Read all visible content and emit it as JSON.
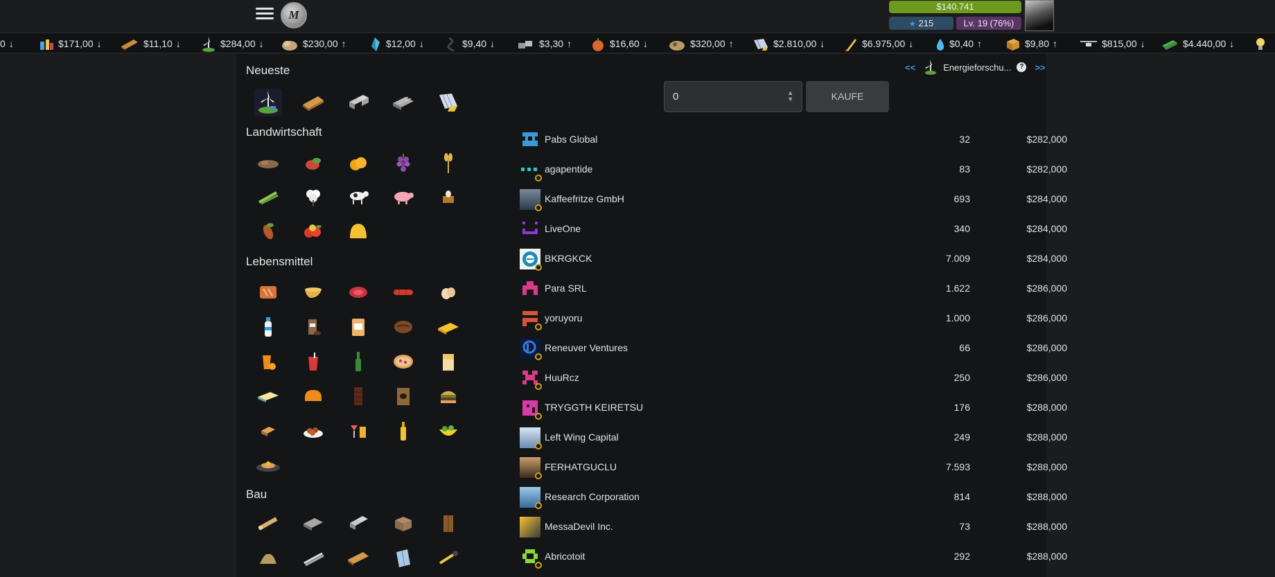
{
  "header": {
    "menu_icon": "hamburger-icon",
    "logo_letter": "M",
    "money": "$140.741",
    "rating": "215",
    "level": "Lv. 19 (76%)"
  },
  "ticker": [
    {
      "price": "0",
      "dir": "down",
      "icon": "cut-off-icon"
    },
    {
      "price": "$171,00",
      "dir": "down",
      "icon": "chemicals-icon"
    },
    {
      "price": "$11,10",
      "dir": "down",
      "icon": "planks-icon"
    },
    {
      "price": "$284,00",
      "dir": "down",
      "icon": "wind-turbine-icon"
    },
    {
      "price": "$230,00",
      "dir": "up",
      "icon": "sack-icon"
    },
    {
      "price": "$12,00",
      "dir": "down",
      "icon": "crystal-icon"
    },
    {
      "price": "$9,40",
      "dir": "down",
      "icon": "cable-icon"
    },
    {
      "price": "$3,30",
      "dir": "up",
      "icon": "bricks-icon"
    },
    {
      "price": "$16,60",
      "dir": "down",
      "icon": "pumpkin-icon"
    },
    {
      "price": "$320,00",
      "dir": "up",
      "icon": "ore-icon"
    },
    {
      "price": "$2.810,00",
      "dir": "down",
      "icon": "solar-panel-icon"
    },
    {
      "price": "$6.975,00",
      "dir": "down",
      "icon": "rocket-icon"
    },
    {
      "price": "$0,40",
      "dir": "up",
      "icon": "water-icon"
    },
    {
      "price": "$9,80",
      "dir": "up",
      "icon": "box-icon"
    },
    {
      "price": "$815,00",
      "dir": "down",
      "icon": "drone-icon"
    },
    {
      "price": "$4.440,00",
      "dir": "down",
      "icon": "cash-icon"
    },
    {
      "price": "",
      "dir": "",
      "icon": "bulb-icon"
    }
  ],
  "categories": {
    "newest": "Neueste",
    "agriculture": "Landwirtschaft",
    "food": "Lebensmittel",
    "construction": "Bau"
  },
  "buy": {
    "quantity": "0",
    "button": "KAUFE"
  },
  "product_nav": {
    "prev": "<<",
    "next": ">>",
    "product": "Energieforschu...",
    "help": "?"
  },
  "sellers": [
    {
      "name": "Pabs Global",
      "qty": "32",
      "price": "$282,000"
    },
    {
      "name": "agapentide",
      "qty": "83",
      "price": "$282,000"
    },
    {
      "name": "Kaffeefritze GmbH",
      "qty": "693",
      "price": "$284,000"
    },
    {
      "name": "LiveOne",
      "qty": "340",
      "price": "$284,000"
    },
    {
      "name": "BKRGKCK",
      "qty": "7.009",
      "price": "$284,000"
    },
    {
      "name": "Para SRL",
      "qty": "1.622",
      "price": "$286,000"
    },
    {
      "name": "yoruyoru",
      "qty": "1.000",
      "price": "$286,000"
    },
    {
      "name": "Reneuver Ventures",
      "qty": "66",
      "price": "$286,000"
    },
    {
      "name": "HuuRcz",
      "qty": "250",
      "price": "$286,000"
    },
    {
      "name": "TRYGGTH KEIRETSU",
      "qty": "176",
      "price": "$288,000"
    },
    {
      "name": "Left Wing Capital",
      "qty": "249",
      "price": "$288,000"
    },
    {
      "name": "FERHATGUCLU",
      "qty": "7.593",
      "price": "$288,000"
    },
    {
      "name": "Research Corporation",
      "qty": "814",
      "price": "$288,000"
    },
    {
      "name": "MessaDevil Inc.",
      "qty": "73",
      "price": "$288,000"
    },
    {
      "name": "Abricotoit",
      "qty": "292",
      "price": "$288,000"
    }
  ]
}
